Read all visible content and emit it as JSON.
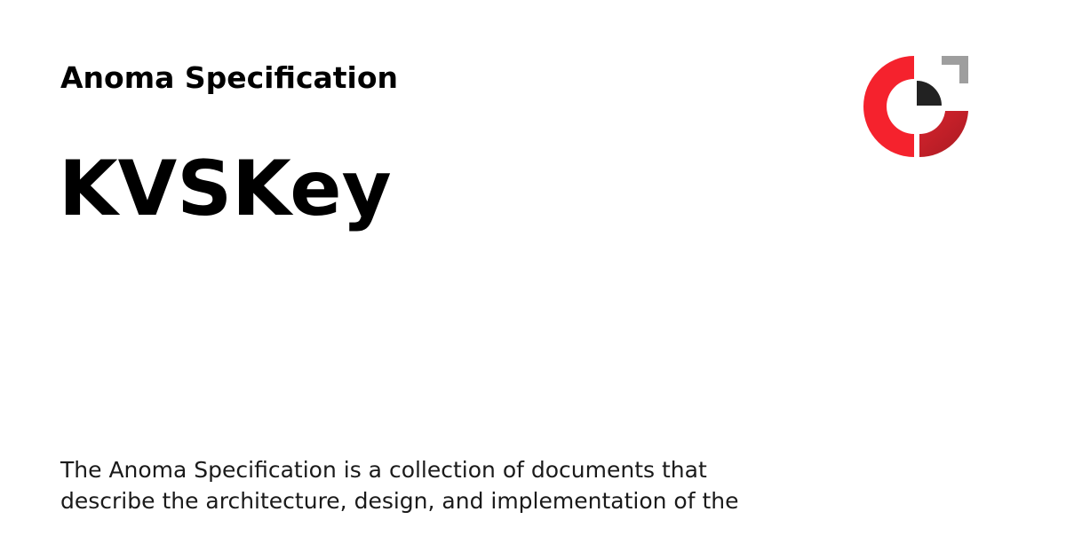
{
  "header": {
    "site_name": "Anoma Specification"
  },
  "page": {
    "title": "KVSKey",
    "description": "The Anoma Specification is a collection of documents that describe the architecture, design, and implementation of the"
  },
  "logo": {
    "icon": "anoma-logo-icon",
    "colors": {
      "red_bright": "#f5222d",
      "red_dark": "#b71c22",
      "charcoal": "#222222",
      "gray": "#9e9e9e"
    }
  }
}
